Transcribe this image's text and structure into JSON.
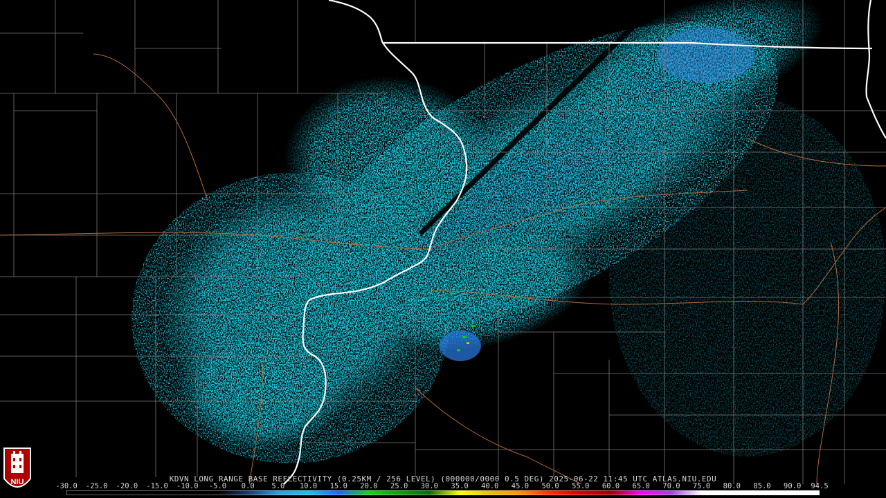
{
  "title": "KDVN LONG RANGE BASE REFLECTIVITY (0.25KM / 256 LEVEL) (000000/0000 0.5 DEG) 2025-06-22 11:45 UTC  ATLAS.NIU.EDU",
  "logo_text": "NIU",
  "colorbar": {
    "min": -30.0,
    "max": 94.5,
    "ticks": [
      "-30.0",
      "-25.0",
      "-20.0",
      "-15.0",
      "-10.0",
      "-5.0",
      "0.0",
      "5.0",
      "10.0",
      "15.0",
      "20.0",
      "25.0",
      "30.0",
      "35.0",
      "40.0",
      "45.0",
      "50.0",
      "55.0",
      "60.0",
      "65.0",
      "70.0",
      "75.0",
      "80.0",
      "85.0",
      "90.0",
      "94.5"
    ],
    "tick_values": [
      -30,
      -25,
      -20,
      -15,
      -10,
      -5,
      0,
      5,
      10,
      15,
      20,
      25,
      30,
      35,
      40,
      45,
      50,
      55,
      60,
      65,
      70,
      75,
      80,
      85,
      90,
      94.5
    ],
    "color_stops": [
      {
        "dbz": -30,
        "color": "#000000"
      },
      {
        "dbz": -5,
        "color": "#000000"
      },
      {
        "dbz": 0,
        "color": "#1a3a6a"
      },
      {
        "dbz": 5,
        "color": "#2a9ee0"
      },
      {
        "dbz": 10,
        "color": "#17c3e6"
      },
      {
        "dbz": 15,
        "color": "#1e66ff"
      },
      {
        "dbz": 20,
        "color": "#14d414"
      },
      {
        "dbz": 25,
        "color": "#0ea10e"
      },
      {
        "dbz": 30,
        "color": "#0a6e0a"
      },
      {
        "dbz": 35,
        "color": "#ffff00"
      },
      {
        "dbz": 40,
        "color": "#e8c200"
      },
      {
        "dbz": 45,
        "color": "#ff9000"
      },
      {
        "dbz": 50,
        "color": "#ff2a00"
      },
      {
        "dbz": 55,
        "color": "#d40000"
      },
      {
        "dbz": 60,
        "color": "#a00000"
      },
      {
        "dbz": 65,
        "color": "#ff00ff"
      },
      {
        "dbz": 70,
        "color": "#9d48d8"
      },
      {
        "dbz": 75,
        "color": "#ffffff"
      },
      {
        "dbz": 94.5,
        "color": "#ffffff"
      }
    ]
  },
  "colors": {
    "background": "#000000",
    "state_border": "#ffffff",
    "county_border": "#7a7a7a",
    "highway": "#b86a3a",
    "echo_main": "#1fd0e6",
    "echo_strong": "#2a8ee8",
    "echo_green": "#10c010"
  }
}
